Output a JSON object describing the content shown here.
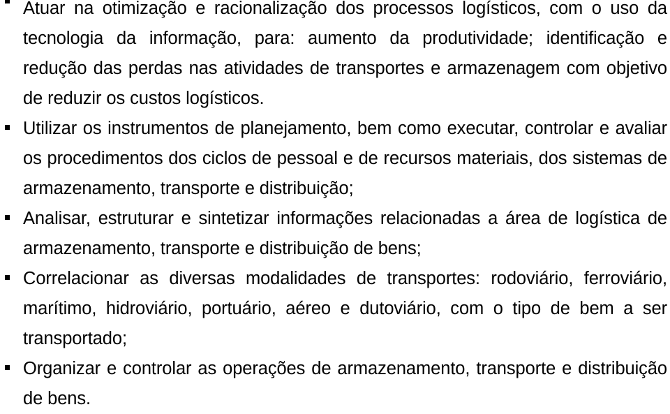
{
  "document": {
    "language": "pt-BR",
    "background_color": "#ffffff",
    "text_color": "#000000",
    "bullet_glyph": "square-bullet",
    "bullets": [
      {
        "text": "Atuar na otimização e racionalização dos processos logísticos, com o uso da tecnologia da informação, para: aumento da produtividade; identificação e redução das perdas nas atividades de transportes e armazenagem com objetivo de reduzir os custos logísticos."
      },
      {
        "text": "Utilizar os instrumentos de planejamento, bem como executar, controlar e avaliar os procedimentos dos ciclos de pessoal e de recursos materiais, dos sistemas de armazenamento, transporte e distribuição;"
      },
      {
        "text": "Analisar, estruturar e sintetizar informações relacionadas a área de logística de armazenamento, transporte e distribuição de bens;"
      },
      {
        "text": "Correlacionar as diversas modalidades de transportes: rodoviário, ferroviário, marítimo, hidroviário, portuário, aéreo e dutoviário, com o tipo de bem a ser transportado;"
      },
      {
        "text": "Organizar e controlar as operações de armazenamento, transporte e distribuição de bens."
      }
    ]
  }
}
